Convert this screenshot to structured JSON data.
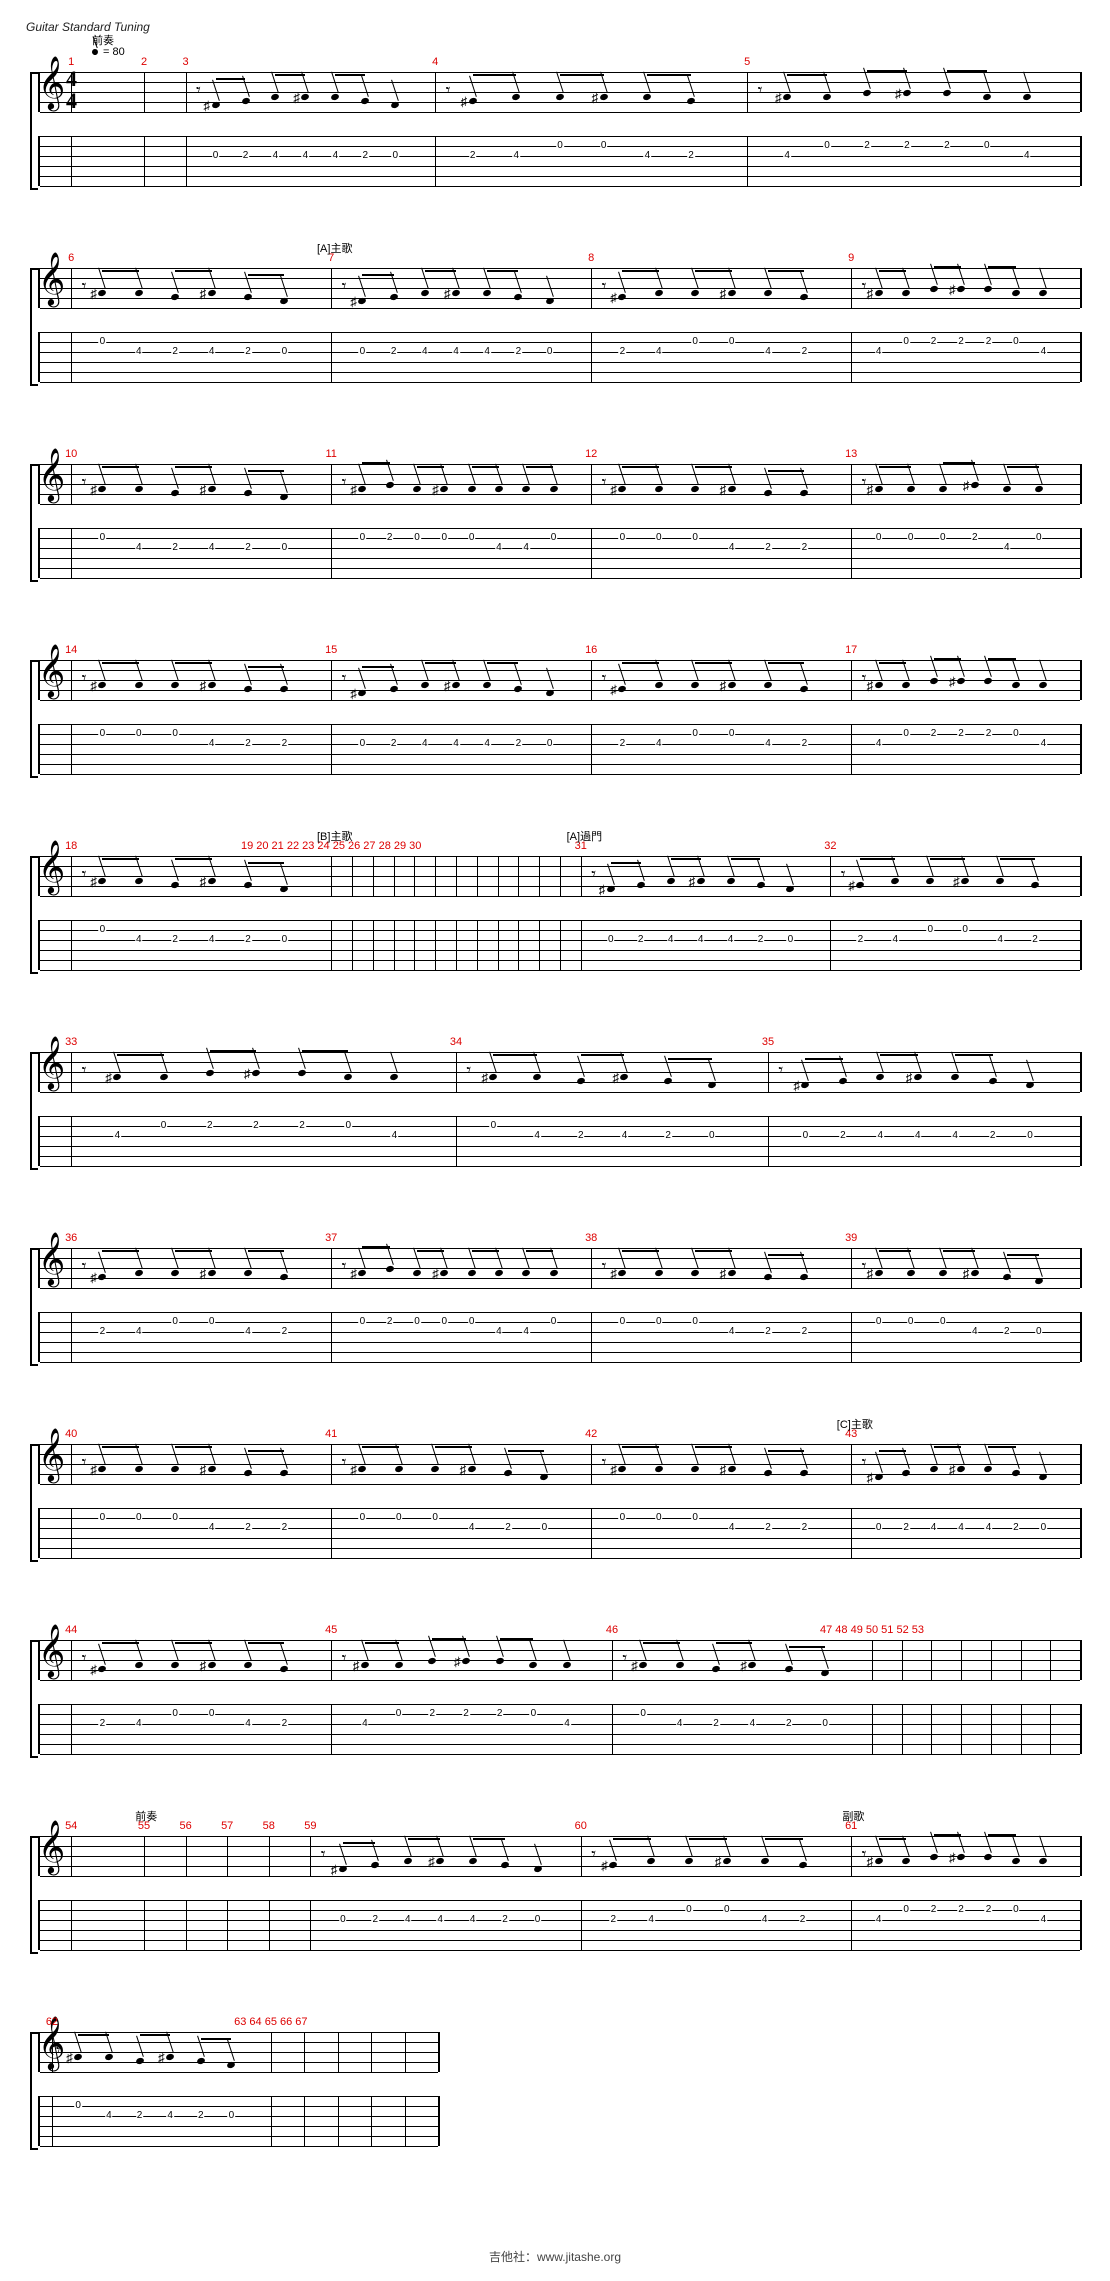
{
  "tuning_label": "Guitar Standard Tuning",
  "tempo_bpm": "= 80",
  "time_signature": {
    "top": "4",
    "bottom": "4"
  },
  "sections": {
    "prelude": "前奏",
    "a_verse": "[A]主歌",
    "b_verse": "[B]主歌",
    "a_bridge": "[A]過門",
    "c_verse": "[C]主歌",
    "chorus": "副歌"
  },
  "footer": "吉他社：www.jitashe.org",
  "tab_patterns": {
    "p1": [
      [
        3,
        0
      ],
      [
        3,
        2
      ],
      [
        3,
        4
      ],
      [
        3,
        4
      ],
      [
        3,
        4
      ],
      [
        3,
        2
      ],
      [
        3,
        0
      ]
    ],
    "p2": [
      [
        3,
        2
      ],
      [
        3,
        4
      ],
      [
        2,
        0
      ],
      [
        2,
        0
      ],
      [
        3,
        4
      ],
      [
        3,
        2
      ]
    ],
    "p3": [
      [
        3,
        4
      ],
      [
        2,
        0
      ],
      [
        2,
        2
      ],
      [
        2,
        2
      ],
      [
        2,
        2
      ],
      [
        2,
        0
      ],
      [
        3,
        4
      ]
    ],
    "p4": [
      [
        2,
        0
      ],
      [
        3,
        4
      ],
      [
        3,
        2
      ],
      [
        3,
        4
      ],
      [
        3,
        2
      ],
      [
        3,
        0
      ]
    ],
    "p5": [
      [
        2,
        0
      ],
      [
        2,
        2
      ],
      [
        2,
        0
      ],
      [
        2,
        0
      ],
      [
        2,
        0
      ],
      [
        3,
        4
      ],
      [
        3,
        4
      ],
      [
        2,
        0
      ]
    ],
    "p6": [
      [
        2,
        0
      ],
      [
        2,
        0
      ],
      [
        2,
        0
      ],
      [
        3,
        4
      ],
      [
        3,
        2
      ],
      [
        3,
        2
      ]
    ],
    "p7": [
      [
        2,
        0
      ],
      [
        2,
        0
      ],
      [
        2,
        0
      ],
      [
        2,
        2
      ],
      [
        3,
        4
      ],
      [
        2,
        0
      ]
    ],
    "p8": [
      [
        2,
        0
      ],
      [
        2,
        0
      ],
      [
        2,
        0
      ],
      [
        3,
        4
      ],
      [
        3,
        2
      ],
      [
        3,
        0
      ]
    ]
  },
  "lines": [
    {
      "first_bar": 1,
      "show_clef": true,
      "show_timesig": true,
      "tempo_section": "prelude",
      "bars": [
        {
          "num": "1",
          "pct": 3,
          "empty": true
        },
        {
          "num": "2",
          "pct": 10,
          "empty": true
        },
        {
          "num": "3",
          "pct": 14,
          "pattern": "p1"
        },
        {
          "num": "4",
          "pct": 38,
          "pattern": "p2"
        },
        {
          "num": "5",
          "pct": 68,
          "pattern": "p3"
        }
      ],
      "end_pct": 100
    },
    {
      "first_bar": 6,
      "show_clef": true,
      "bars": [
        {
          "num": "6",
          "pct": 3,
          "pattern": "p4"
        },
        {
          "num": "7",
          "pct": 28,
          "pattern": "p1",
          "section": "a_verse"
        },
        {
          "num": "8",
          "pct": 53,
          "pattern": "p2"
        },
        {
          "num": "9",
          "pct": 78,
          "pattern": "p3"
        }
      ],
      "end_pct": 100
    },
    {
      "first_bar": 10,
      "show_clef": true,
      "bars": [
        {
          "num": "10",
          "pct": 3,
          "pattern": "p4"
        },
        {
          "num": "11",
          "pct": 28,
          "pattern": "p5"
        },
        {
          "num": "12",
          "pct": 53,
          "pattern": "p6"
        },
        {
          "num": "13",
          "pct": 78,
          "pattern": "p7"
        }
      ],
      "end_pct": 100
    },
    {
      "first_bar": 14,
      "show_clef": true,
      "bars": [
        {
          "num": "14",
          "pct": 3,
          "pattern": "p6"
        },
        {
          "num": "15",
          "pct": 28,
          "pattern": "p1"
        },
        {
          "num": "16",
          "pct": 53,
          "pattern": "p2"
        },
        {
          "num": "17",
          "pct": 78,
          "pattern": "p3"
        }
      ],
      "end_pct": 100
    },
    {
      "first_bar": 18,
      "show_clef": true,
      "bars": [
        {
          "num": "18",
          "pct": 3,
          "pattern": "p4"
        },
        {
          "num": "19 20 21 22 23 24 25 26 27 28 29 30",
          "pct": 28,
          "narrow": 12,
          "section": "b_verse"
        },
        {
          "num": "31",
          "pct": 52,
          "pattern": "p1",
          "section": "a_bridge"
        },
        {
          "num": "32",
          "pct": 76,
          "pattern": "p2"
        }
      ],
      "end_pct": 100
    },
    {
      "first_bar": 33,
      "show_clef": true,
      "bars": [
        {
          "num": "33",
          "pct": 3,
          "pattern": "p3",
          "wide": true
        },
        {
          "num": "34",
          "pct": 40,
          "pattern": "p4"
        },
        {
          "num": "35",
          "pct": 70,
          "pattern": "p1"
        }
      ],
      "end_pct": 100
    },
    {
      "first_bar": 36,
      "show_clef": true,
      "bars": [
        {
          "num": "36",
          "pct": 3,
          "pattern": "p2"
        },
        {
          "num": "37",
          "pct": 28,
          "pattern": "p5"
        },
        {
          "num": "38",
          "pct": 53,
          "pattern": "p6"
        },
        {
          "num": "39",
          "pct": 78,
          "pattern": "p8"
        }
      ],
      "end_pct": 100
    },
    {
      "first_bar": 40,
      "show_clef": true,
      "bars": [
        {
          "num": "40",
          "pct": 3,
          "pattern": "p6"
        },
        {
          "num": "41",
          "pct": 28,
          "pattern": "p8"
        },
        {
          "num": "42",
          "pct": 53,
          "pattern": "p6"
        },
        {
          "num": "43",
          "pct": 78,
          "pattern": "p1",
          "section": "c_verse"
        }
      ],
      "end_pct": 100
    },
    {
      "first_bar": 44,
      "show_clef": true,
      "bars": [
        {
          "num": "44",
          "pct": 3,
          "pattern": "p2"
        },
        {
          "num": "45",
          "pct": 28,
          "pattern": "p3"
        },
        {
          "num": "46",
          "pct": 55,
          "pattern": "p4"
        },
        {
          "num": "47 48 49 50 51 52 53",
          "pct": 80,
          "narrow": 7
        }
      ],
      "end_pct": 100
    },
    {
      "first_bar": 54,
      "show_clef": true,
      "bars": [
        {
          "num": "54",
          "pct": 3,
          "empty": true
        },
        {
          "num": "55",
          "pct": 10,
          "empty": true,
          "section": "prelude"
        },
        {
          "num": "56",
          "pct": 14,
          "empty": true
        },
        {
          "num": "57",
          "pct": 18,
          "empty": true
        },
        {
          "num": "58",
          "pct": 22,
          "empty": true
        },
        {
          "num": "59",
          "pct": 26,
          "pattern": "p1"
        },
        {
          "num": "60",
          "pct": 52,
          "pattern": "p2"
        },
        {
          "num": "61",
          "pct": 78,
          "pattern": "p3",
          "section": "chorus"
        }
      ],
      "end_pct": 100
    },
    {
      "first_bar": 62,
      "show_clef": true,
      "short": true,
      "bars": [
        {
          "num": "62",
          "pct": 3,
          "pattern": "p4"
        },
        {
          "num": "63 64 65 66 67",
          "pct": 58,
          "narrow": 5
        }
      ],
      "end_pct": 100
    }
  ]
}
